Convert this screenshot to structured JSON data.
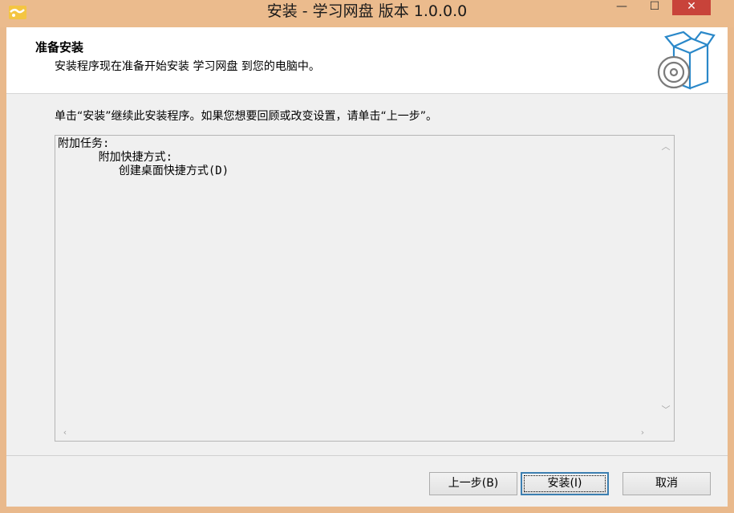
{
  "window": {
    "title": "安装 - 学习网盘 版本 1.0.0.0",
    "minimize_glyph": "—",
    "maximize_glyph": "☐",
    "close_glyph": "✕"
  },
  "header": {
    "heading": "准备安装",
    "subheading": "安装程序现在准备开始安装 学习网盘 到您的电脑中。"
  },
  "instruction": "单击“安装”继续此安装程序。如果您想要回顾或改变设置，请单击“上一步”。",
  "memo": {
    "lines": [
      "附加任务:",
      "      附加快捷方式:",
      "         创建桌面快捷方式(D)"
    ]
  },
  "buttons": {
    "back": "上一步(B)",
    "install": "安装(I)",
    "cancel": "取消"
  },
  "icons": {
    "app": "app-folder-icon",
    "install": "install-box-disc-icon"
  },
  "colors": {
    "frame": "#e9b98c",
    "close": "#c8433a",
    "graphic": "#2a88c9"
  }
}
